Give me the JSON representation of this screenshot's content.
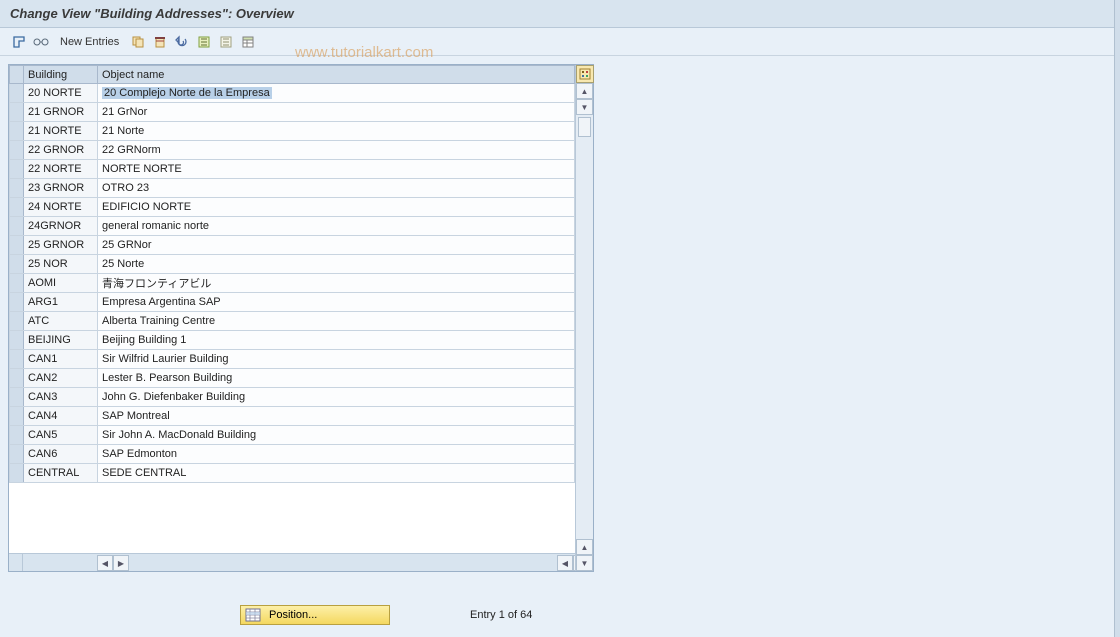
{
  "title": "Change View \"Building Addresses\": Overview",
  "toolbar": {
    "new_entries": "New Entries"
  },
  "watermark": "www.tutorialkart.com",
  "table": {
    "headers": {
      "building": "Building",
      "name": "Object name"
    },
    "rows": [
      {
        "building": "20 NORTE",
        "name": "20 Complejo Norte de la Empresa"
      },
      {
        "building": "21 GRNOR",
        "name": "21 GrNor"
      },
      {
        "building": "21 NORTE",
        "name": "21 Norte"
      },
      {
        "building": "22 GRNOR",
        "name": "22 GRNorm"
      },
      {
        "building": "22 NORTE",
        "name": "NORTE NORTE"
      },
      {
        "building": "23 GRNOR",
        "name": "OTRO 23"
      },
      {
        "building": "24 NORTE",
        "name": "EDIFICIO NORTE"
      },
      {
        "building": "24GRNOR",
        "name": "general romanic norte"
      },
      {
        "building": "25 GRNOR",
        "name": "25 GRNor"
      },
      {
        "building": "25 NOR",
        "name": "25 Norte"
      },
      {
        "building": "AOMI",
        "name": "青海フロンティアビル"
      },
      {
        "building": "ARG1",
        "name": "Empresa Argentina SAP"
      },
      {
        "building": "ATC",
        "name": "Alberta Training Centre"
      },
      {
        "building": "BEIJING",
        "name": "Beijing Building 1"
      },
      {
        "building": "CAN1",
        "name": "Sir Wilfrid Laurier Building"
      },
      {
        "building": "CAN2",
        "name": "Lester B. Pearson Building"
      },
      {
        "building": "CAN3",
        "name": "John G. Diefenbaker Building"
      },
      {
        "building": "CAN4",
        "name": "SAP Montreal"
      },
      {
        "building": "CAN5",
        "name": "Sir John A. MacDonald Building"
      },
      {
        "building": "CAN6",
        "name": "SAP Edmonton"
      },
      {
        "building": "CENTRAL",
        "name": "SEDE CENTRAL"
      }
    ]
  },
  "footer": {
    "position_label": "Position...",
    "entry_text": "Entry 1 of 64"
  }
}
